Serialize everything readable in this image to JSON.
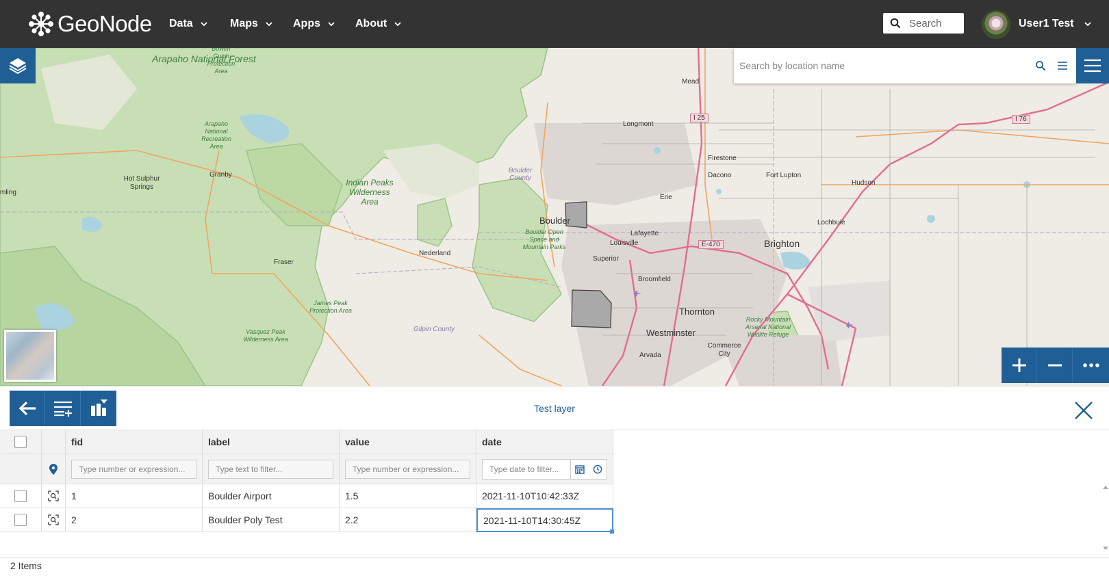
{
  "navbar": {
    "brand": "GeoNode",
    "menu": [
      {
        "label": "Data"
      },
      {
        "label": "Maps"
      },
      {
        "label": "Apps"
      },
      {
        "label": "About"
      }
    ],
    "search_placeholder": "Search",
    "user_name": "User1 Test"
  },
  "map": {
    "search_placeholder": "Search by location name",
    "labels": [
      {
        "text": "Arapaho National Forest",
        "kind": "park"
      },
      {
        "text": "Bowen Gulch Protection Area",
        "kind": "park"
      },
      {
        "text": "Arapaho National Recreation Area",
        "kind": "park"
      },
      {
        "text": "Indian Peaks Wilderness Area",
        "kind": "park"
      },
      {
        "text": "James Peak Protection Area",
        "kind": "park"
      },
      {
        "text": "Vasquez Peak Wilderness Area",
        "kind": "park"
      },
      {
        "text": "Boulder Open Space and Mountain Parks",
        "kind": "park"
      },
      {
        "text": "Rocky Mountain Arsenal National Wildlife Refuge",
        "kind": "park"
      },
      {
        "text": "Boulder County",
        "kind": "county"
      },
      {
        "text": "Gilpin County",
        "kind": "county"
      },
      {
        "text": "Hot Sulphur Springs",
        "kind": "town"
      },
      {
        "text": "Granby",
        "kind": "town"
      },
      {
        "text": "mling",
        "kind": "town"
      },
      {
        "text": "Fraser",
        "kind": "town"
      },
      {
        "text": "Nederland",
        "kind": "town"
      },
      {
        "text": "Boulder",
        "kind": "city"
      },
      {
        "text": "Longmont",
        "kind": "town"
      },
      {
        "text": "Mead",
        "kind": "town"
      },
      {
        "text": "Firestone",
        "kind": "town"
      },
      {
        "text": "Dacono",
        "kind": "town"
      },
      {
        "text": "Fort Lupton",
        "kind": "town"
      },
      {
        "text": "Erie",
        "kind": "town"
      },
      {
        "text": "Hudson",
        "kind": "town"
      },
      {
        "text": "Lafayette",
        "kind": "town"
      },
      {
        "text": "Louisville",
        "kind": "town"
      },
      {
        "text": "Lochbuie",
        "kind": "town"
      },
      {
        "text": "Brighton",
        "kind": "city"
      },
      {
        "text": "Superior",
        "kind": "town"
      },
      {
        "text": "Broomfield",
        "kind": "town"
      },
      {
        "text": "Thornton",
        "kind": "city"
      },
      {
        "text": "Westminster",
        "kind": "city"
      },
      {
        "text": "Arvada",
        "kind": "town"
      },
      {
        "text": "Commerce City",
        "kind": "town"
      },
      {
        "text": "I 25",
        "kind": "shield"
      },
      {
        "text": "I 76",
        "kind": "shield"
      },
      {
        "text": "E-470",
        "kind": "shield"
      }
    ]
  },
  "panel": {
    "title": "Test layer",
    "toolbar": [
      {
        "icon": "back-arrow-icon"
      },
      {
        "icon": "columns-icon"
      },
      {
        "icon": "sync-map-icon"
      }
    ],
    "columns": [
      {
        "label": "fid",
        "filter_placeholder": "Type number or expression..."
      },
      {
        "label": "label",
        "filter_placeholder": "Type text to filter..."
      },
      {
        "label": "value",
        "filter_placeholder": "Type number or expression..."
      },
      {
        "label": "date",
        "filter_placeholder": "Type date to filter..."
      }
    ],
    "rows": [
      {
        "fid": "1",
        "label": "Boulder Airport",
        "value": "1.5",
        "date": "2021-11-10T10:42:33Z"
      },
      {
        "fid": "2",
        "label": "Boulder Poly Test",
        "value": "2.2",
        "date": "2021-11-10T14:30:45Z"
      }
    ],
    "count_text": "2 Items"
  },
  "colors": {
    "navbar": "#333333",
    "primary": "#1f5f96",
    "park_green": "#c8dfb5",
    "map_background": "#eeece4"
  }
}
